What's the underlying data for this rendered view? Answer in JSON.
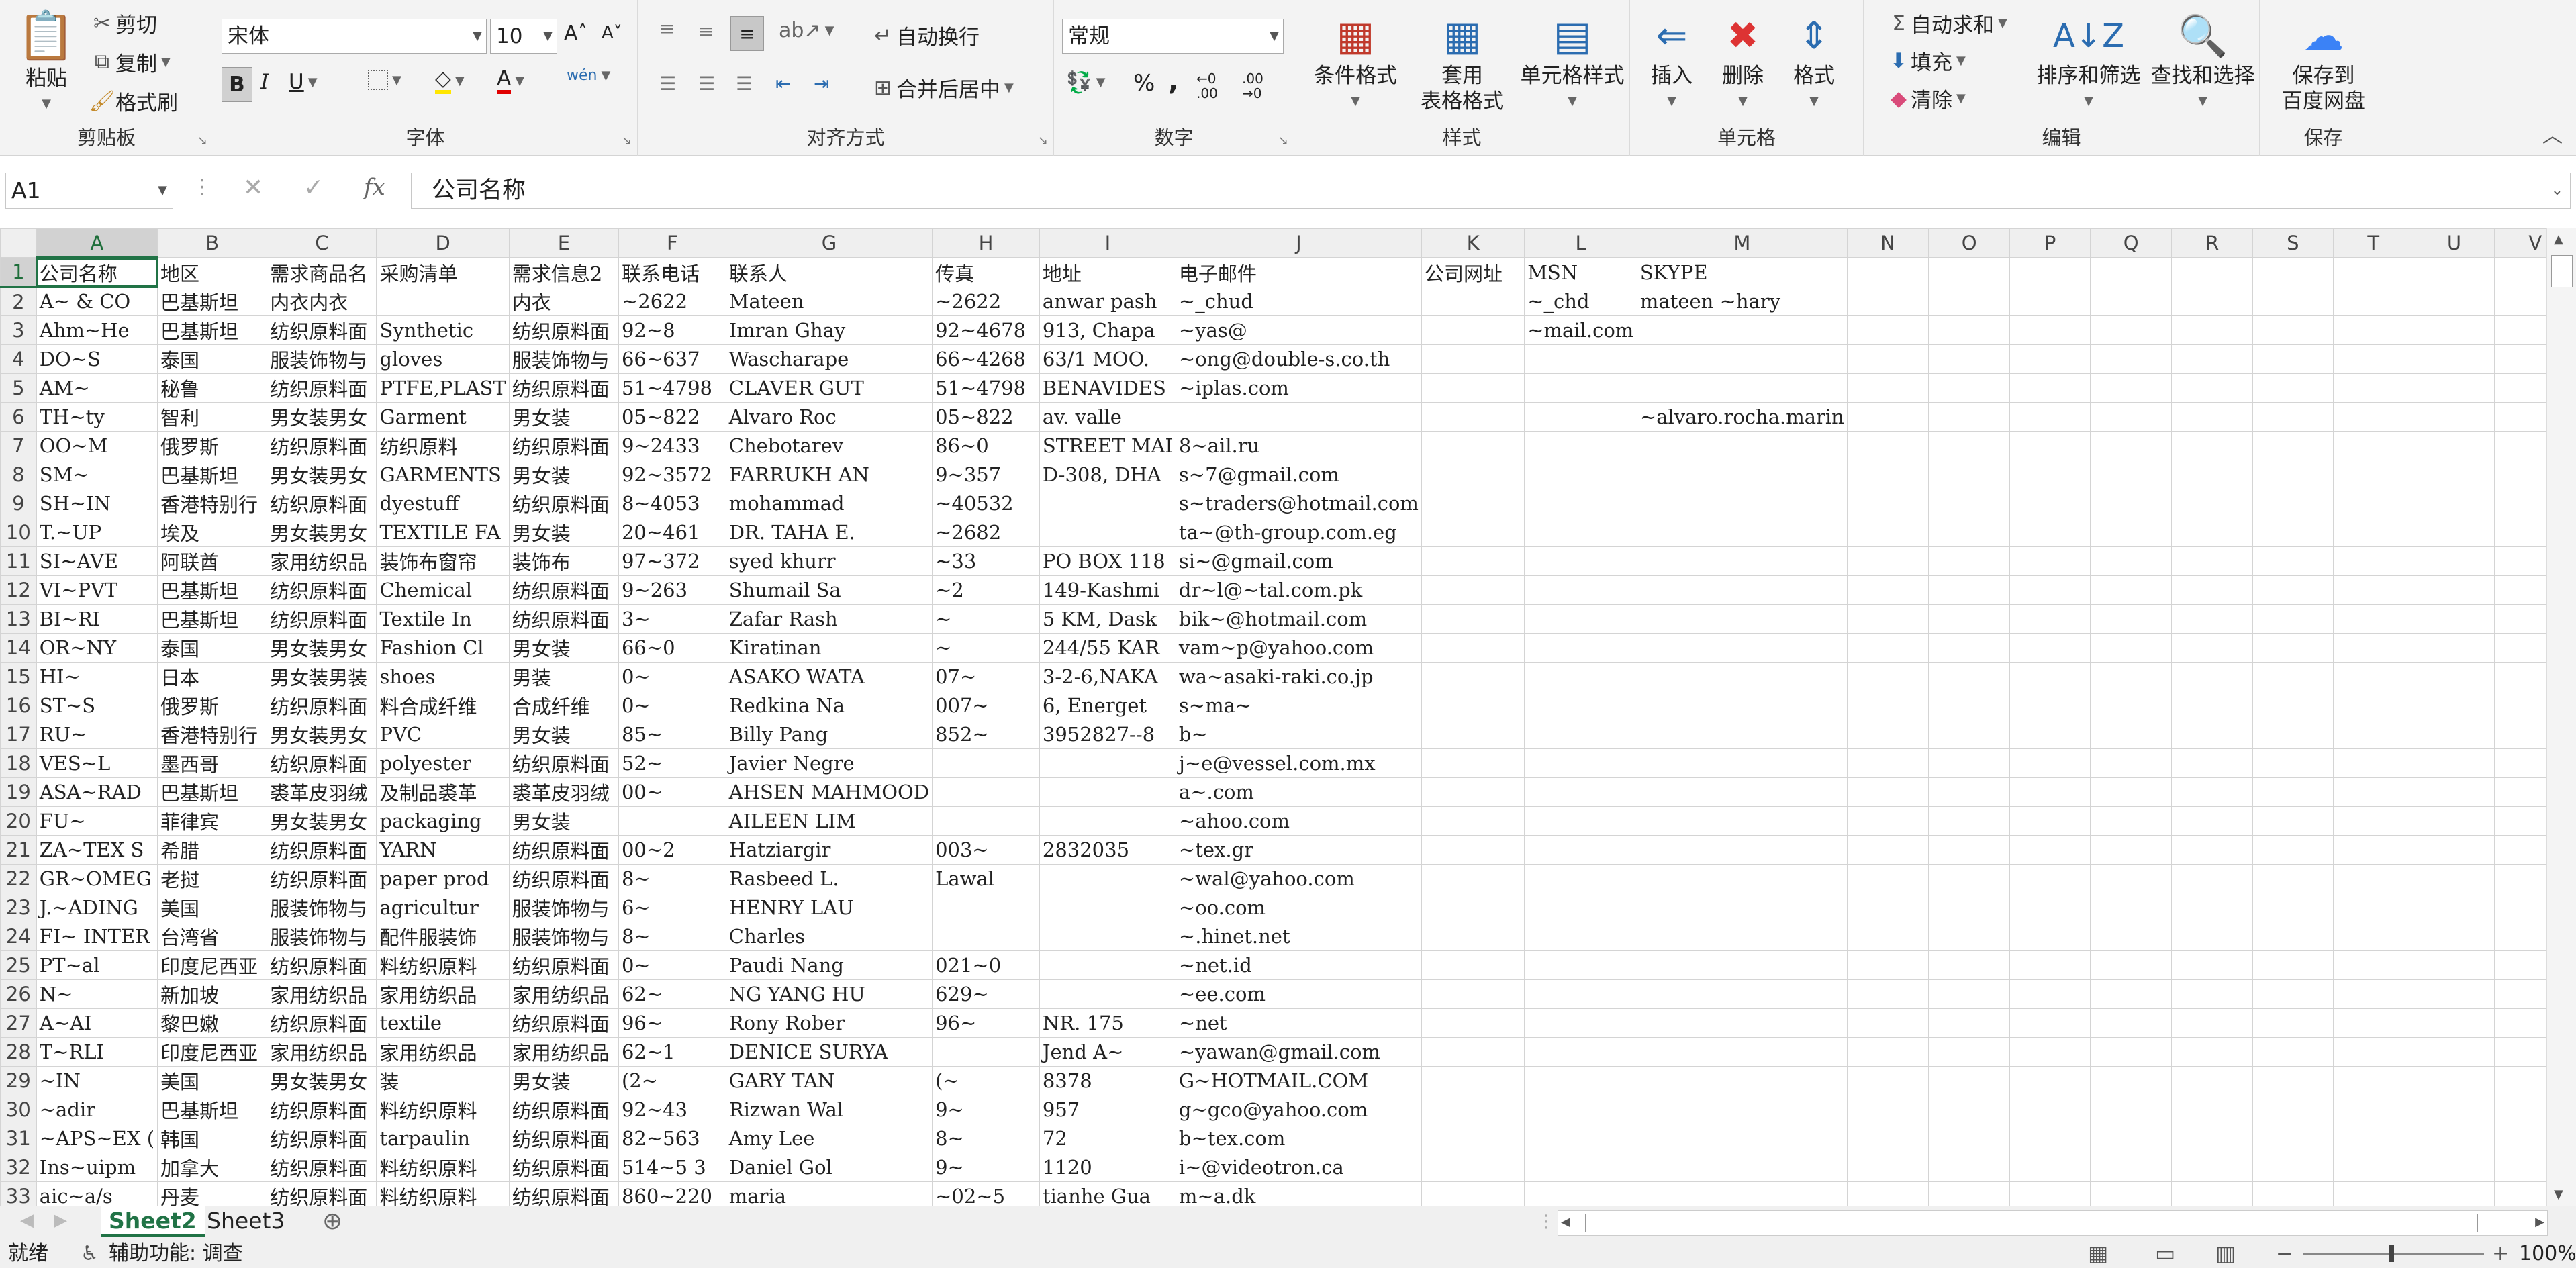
{
  "ribbon": {
    "clipboard": {
      "label": "剪贴板",
      "paste": "粘贴",
      "cut": "剪切",
      "copy": "复制",
      "format_painter": "格式刷"
    },
    "font": {
      "label": "字体",
      "font_name": "宋体",
      "font_size": "10",
      "bold": "B",
      "italic": "I",
      "underline": "U",
      "phonetic": "wén"
    },
    "alignment": {
      "label": "对齐方式",
      "wrap": "自动换行",
      "merge": "合并后居中"
    },
    "number": {
      "label": "数字",
      "format": "常规",
      "percent": "%",
      "comma": ","
    },
    "styles": {
      "label": "样式",
      "conditional": "条件格式",
      "table1": "套用",
      "table2": "表格格式",
      "cell_styles": "单元格样式"
    },
    "cells": {
      "label": "单元格",
      "insert": "插入",
      "delete": "删除",
      "format": "格式"
    },
    "editing": {
      "label": "编辑",
      "autosum": "自动求和",
      "fill": "填充",
      "clear": "清除",
      "sort": "排序和筛选",
      "find": "查找和选择"
    },
    "save": {
      "label": "保存",
      "btn1": "保存到",
      "btn2": "百度网盘"
    }
  },
  "formula_bar": {
    "name_box": "A1",
    "fx": "fx",
    "content": "公司名称"
  },
  "columns": [
    "A",
    "B",
    "C",
    "D",
    "E",
    "F",
    "G",
    "H",
    "I",
    "J",
    "K",
    "L",
    "M",
    "N",
    "O",
    "P",
    "Q",
    "R",
    "S",
    "T",
    "U",
    "V"
  ],
  "rows": [
    [
      "公司名称",
      "地区",
      "需求商品名",
      "采购清单",
      "需求信息2",
      "联系电话",
      "联系人",
      "传真",
      "地址",
      "电子邮件",
      "公司网址",
      "MSN",
      "SKYPE"
    ],
    [
      "A~ & CO",
      "巴基斯坦",
      "内衣内衣",
      "",
      "内衣",
      "~2622",
      "Mateen",
      "~2622",
      "anwar pash",
      "~_chud",
      "",
      "~_chd",
      "mateen ~hary"
    ],
    [
      "Ahm~He",
      "巴基斯坦",
      "纺织原料面",
      "Synthetic",
      "纺织原料面",
      "92~8",
      "Imran Ghay",
      "92~4678",
      "913, Chapa",
      "~yas@",
      "",
      "~mail.com",
      ""
    ],
    [
      "DO~S",
      "泰国",
      "服装饰物与",
      "gloves",
      "服装饰物与",
      "66~637",
      "Wascharape",
      "66~4268",
      "63/1 MOO.",
      "~ong@double-s.co.th",
      "",
      "",
      ""
    ],
    [
      "AM~",
      "秘鲁",
      "纺织原料面",
      "PTFE,PLAST",
      "纺织原料面",
      "51~4798",
      "CLAVER GUT",
      "51~4798",
      "BENAVIDES",
      "~iplas.com",
      "",
      "",
      ""
    ],
    [
      "TH~ty",
      "智利",
      "男女装男女",
      "Garment",
      "男女装",
      "05~822",
      "Alvaro Roc",
      "05~822",
      "av. valle",
      "",
      "",
      "",
      "~alvaro.rocha.marin"
    ],
    [
      "OO~M",
      "俄罗斯",
      "纺织原料面",
      "纺织原料",
      "纺织原料面",
      "9~2433",
      "Chebotarev",
      "86~0",
      "STREET MAI",
      "8~ail.ru",
      "",
      "",
      ""
    ],
    [
      "SM~",
      "巴基斯坦",
      "男女装男女",
      "GARMENTS",
      "男女装",
      "92~3572",
      "FARRUKH AN",
      "9~357",
      "D-308, DHA",
      "s~7@gmail.com",
      "",
      "",
      ""
    ],
    [
      "SH~IN",
      "香港特别行",
      "纺织原料面",
      "dyestuff",
      "纺织原料面",
      "8~4053",
      "mohammad",
      "~40532",
      "",
      "s~traders@hotmail.com",
      "",
      "",
      ""
    ],
    [
      "T.~UP",
      "埃及",
      "男女装男女",
      "TEXTILE FA",
      "男女装",
      "20~461",
      "DR. TAHA E.",
      "~2682",
      "",
      "ta~@th-group.com.eg",
      "",
      "",
      ""
    ],
    [
      "SI~AVE",
      "阿联酋",
      "家用纺织品",
      "装饰布窗帘",
      "装饰布",
      "97~372",
      "syed khurr",
      "~33",
      "PO BOX 118",
      "si~@gmail.com",
      "",
      "",
      ""
    ],
    [
      "VI~PVT",
      "巴基斯坦",
      "纺织原料面",
      "Chemical",
      "纺织原料面",
      "9~263",
      "Shumail Sa",
      "~2",
      "149-Kashmi",
      "dr~l@~tal.com.pk",
      "",
      "",
      ""
    ],
    [
      "BI~RI",
      "巴基斯坦",
      "纺织原料面",
      "Textile In",
      "纺织原料面",
      "3~",
      "Zafar Rash",
      "~",
      "5 KM, Dask",
      "bik~@hotmail.com",
      "",
      "",
      ""
    ],
    [
      "OR~NY",
      "泰国",
      "男女装男女",
      "Fashion Cl",
      "男女装",
      "66~0",
      "Kiratinan",
      "~",
      "244/55 KAR",
      "vam~p@yahoo.com",
      "",
      "",
      ""
    ],
    [
      "HI~",
      "日本",
      "男女装男装",
      "shoes",
      "男装",
      "0~",
      "ASAKO WATA",
      "07~",
      "3-2-6,NAKA",
      "wa~asaki-raki.co.jp",
      "",
      "",
      ""
    ],
    [
      "ST~S",
      "俄罗斯",
      "纺织原料面",
      "料合成纤维",
      "合成纤维",
      "0~",
      "Redkina Na",
      "007~",
      "6, Energet",
      "s~ma~",
      "",
      "",
      ""
    ],
    [
      "RU~",
      "香港特别行",
      "男女装男女",
      "PVC",
      "男女装",
      "85~",
      "Billy Pang",
      "852~",
      "3952827--8",
      "b~",
      "",
      "",
      ""
    ],
    [
      "VES~L",
      "墨西哥",
      "纺织原料面",
      "polyester",
      "纺织原料面",
      "52~",
      "Javier Negre",
      "",
      "",
      "j~e@vessel.com.mx",
      "",
      "",
      ""
    ],
    [
      "ASA~RAD",
      "巴基斯坦",
      "裘革皮羽绒",
      "及制品裘革",
      "裘革皮羽绒",
      "00~",
      "AHSEN MAHMOOD",
      "",
      "",
      "a~.com",
      "",
      "",
      ""
    ],
    [
      "FU~",
      "菲律宾",
      "男女装男女",
      "packaging",
      "男女装",
      "",
      "AILEEN LIM",
      "",
      "",
      "~ahoo.com",
      "",
      "",
      ""
    ],
    [
      "ZA~TEX S",
      "希腊",
      "纺织原料面",
      "YARN",
      "纺织原料面",
      "00~2",
      "Hatziargir",
      "003~",
      "2832035",
      "~tex.gr",
      "",
      "",
      ""
    ],
    [
      "GR~OMEG",
      "老挝",
      "纺织原料面",
      "paper prod",
      "纺织原料面",
      "8~",
      "Rasbeed L.",
      "Lawal",
      "",
      "~wal@yahoo.com",
      "",
      "",
      ""
    ],
    [
      "J.~ADING",
      "美国",
      "服装饰物与",
      "agricultur",
      "服装饰物与",
      "6~",
      "HENRY LAU",
      "",
      "",
      "~oo.com",
      "",
      "",
      ""
    ],
    [
      "FI~ INTER",
      "台湾省",
      "服装饰物与",
      "配件服装饰",
      "服装饰物与",
      "8~",
      "Charles",
      "",
      "",
      "~.hinet.net",
      "",
      "",
      ""
    ],
    [
      "PT~al",
      "印度尼西亚",
      "纺织原料面",
      "料纺织原料",
      "纺织原料面",
      "0~",
      "Paudi Nang",
      "021~0",
      "",
      "~net.id",
      "",
      "",
      ""
    ],
    [
      "N~",
      "新加坡",
      "家用纺织品",
      "家用纺织品",
      "家用纺织品",
      "62~",
      "NG YANG HU",
      "629~",
      "",
      "~ee.com",
      "",
      "",
      ""
    ],
    [
      "A~AI",
      "黎巴嫩",
      "纺织原料面",
      "textile",
      "纺织原料面",
      "96~",
      "Rony Rober",
      "96~",
      "NR. 175",
      "~net",
      "",
      "",
      ""
    ],
    [
      "T~RLI",
      "印度尼西亚",
      "家用纺织品",
      "家用纺织品",
      "家用纺织品",
      "62~1",
      "DENICE SURYA",
      "",
      "Jend A~",
      "~yawan@gmail.com",
      "",
      "",
      ""
    ],
    [
      "~IN",
      "美国",
      "男女装男女",
      "装",
      "男女装",
      "(2~",
      "GARY TAN",
      "(~",
      "8378",
      "G~HOTMAIL.COM",
      "",
      "",
      ""
    ],
    [
      "~adir",
      "巴基斯坦",
      "纺织原料面",
      "料纺织原料",
      "纺织原料面",
      "92~43",
      "Rizwan Wal",
      "9~",
      "957",
      "g~gco@yahoo.com",
      "",
      "",
      ""
    ],
    [
      "~APS~EX (",
      "韩国",
      "纺织原料面",
      "tarpaulin",
      "纺织原料面",
      "82~563",
      "Amy Lee",
      "8~",
      "72",
      "b~tex.com",
      "",
      "",
      ""
    ],
    [
      "Ins~uipm",
      "加拿大",
      "纺织原料面",
      "料纺织原料",
      "纺织原料面",
      "514~5 3",
      "Daniel Gol",
      "9~",
      "1120",
      "i~@videotron.ca",
      "",
      "",
      ""
    ],
    [
      "aic~a/s",
      "丹麦",
      "纺织原料面",
      "料纺织原料",
      "纺织原料面",
      "860~220",
      "maria",
      "~02~5",
      "tianhe Gua",
      "m~a.dk",
      "",
      "",
      ""
    ]
  ],
  "sheet_tabs": [
    "Sheet2",
    "Sheet3"
  ],
  "status": {
    "ready": "就绪",
    "accessibility": "辅助功能: 调查",
    "zoom": "100%"
  }
}
